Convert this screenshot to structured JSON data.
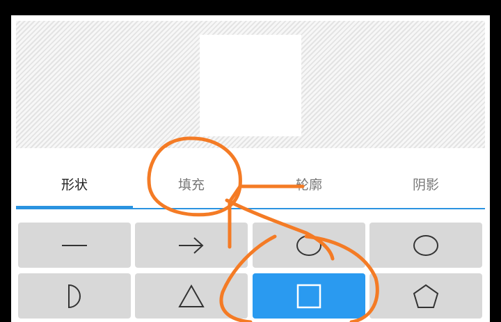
{
  "tabs": [
    {
      "label": "形状",
      "active": true
    },
    {
      "label": "填充",
      "active": false
    },
    {
      "label": "轮廓",
      "active": false
    },
    {
      "label": "阴影",
      "active": false
    }
  ],
  "shapes": [
    {
      "icon": "line-icon",
      "selected": false
    },
    {
      "icon": "arrow-right-icon",
      "selected": false
    },
    {
      "icon": "ellipse-icon",
      "selected": false
    },
    {
      "icon": "circle-icon",
      "selected": false
    },
    {
      "icon": "half-circle-icon",
      "selected": false
    },
    {
      "icon": "triangle-icon",
      "selected": false
    },
    {
      "icon": "square-icon",
      "selected": true
    },
    {
      "icon": "pentagon-icon",
      "selected": false
    }
  ],
  "colors": {
    "accent": "#2a93e0",
    "selected_cell": "#2a9af0",
    "annotation": "#f47b25"
  }
}
